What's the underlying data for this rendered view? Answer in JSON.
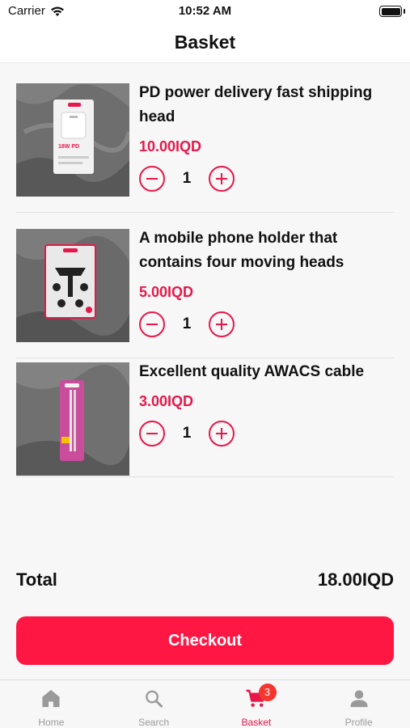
{
  "status": {
    "carrier": "Carrier",
    "time": "10:52 AM"
  },
  "header": {
    "title": "Basket"
  },
  "colors": {
    "accent": "#ff1744",
    "price": "#e8174a",
    "badge": "#f4362f"
  },
  "items": [
    {
      "name": "PD power delivery fast shipping head",
      "price": "10.00IQD",
      "quantity": "1",
      "image_label": "18W PD",
      "image_icon": "charger-product-image"
    },
    {
      "name": "A mobile phone holder that contains four moving heads",
      "price": "5.00IQD",
      "quantity": "1",
      "image_icon": "phone-holder-product-image"
    },
    {
      "name": "Excellent quality AWACS cable",
      "price": "3.00IQD",
      "quantity": "1",
      "image_icon": "cable-product-image"
    }
  ],
  "summary": {
    "total_label": "Total",
    "total_value": "18.00IQD"
  },
  "checkout": {
    "label": "Checkout"
  },
  "tabs": [
    {
      "label": "Home",
      "icon": "home-icon"
    },
    {
      "label": "Search",
      "icon": "search-icon"
    },
    {
      "label": "Basket",
      "icon": "cart-icon",
      "badge": "3",
      "active": true
    },
    {
      "label": "Profile",
      "icon": "profile-icon"
    }
  ]
}
